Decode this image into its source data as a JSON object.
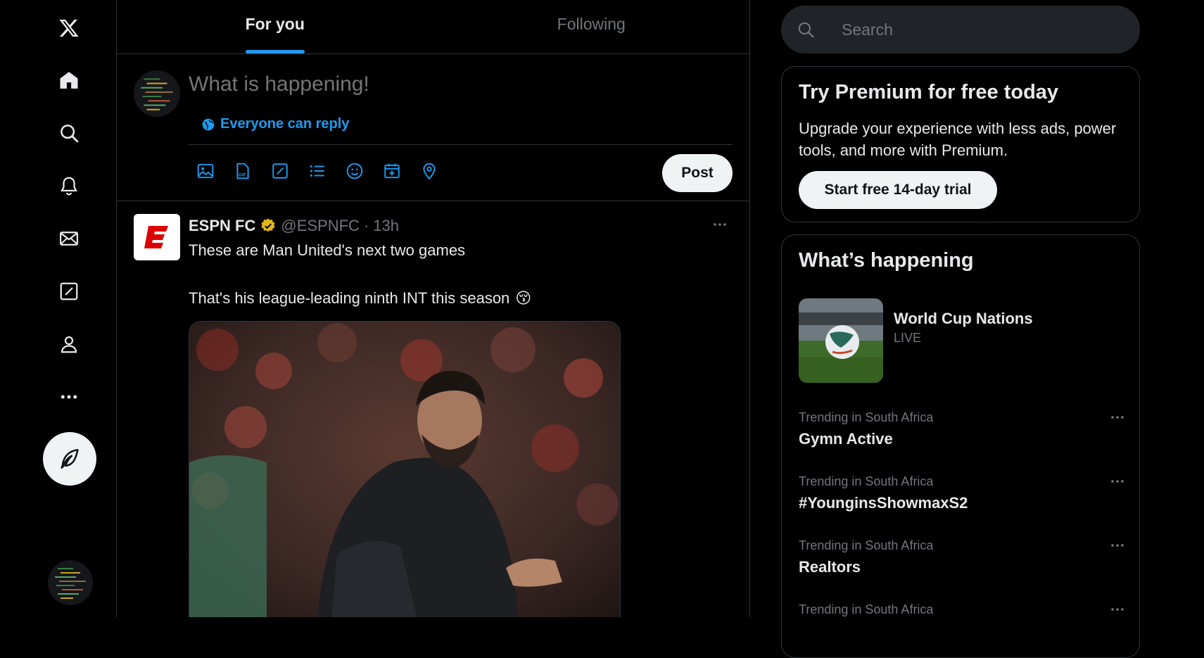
{
  "colors": {
    "background": "#000000",
    "accent": "#1d9bf0",
    "text": "#e7e9ea",
    "muted": "#71767b",
    "border": "#2f3336",
    "button_bg": "#eff3f4"
  },
  "nav": {
    "items": [
      {
        "icon": "x-logo-icon"
      },
      {
        "icon": "home-icon"
      },
      {
        "icon": "search-icon"
      },
      {
        "icon": "bell-icon"
      },
      {
        "icon": "mail-icon"
      },
      {
        "icon": "grok-icon"
      },
      {
        "icon": "profile-icon"
      },
      {
        "icon": "more-icon"
      }
    ],
    "compose_icon": "feather-icon"
  },
  "tabs": [
    {
      "label": "For you",
      "active": true
    },
    {
      "label": "Following",
      "active": false
    }
  ],
  "composer": {
    "placeholder": "What is happening!",
    "reply_scope": "Everyone can reply",
    "tools": [
      "image-icon",
      "gif-icon",
      "grok-icon",
      "poll-icon",
      "emoji-icon",
      "schedule-icon",
      "location-icon"
    ],
    "post_label": "Post"
  },
  "tweet": {
    "name": "ESPN FC",
    "handle": "@ESPNFC",
    "separator": "·",
    "time": "13h",
    "line1": "These are Man United's next two games",
    "line2": "That's his league-leading ninth INT this season",
    "emoji": "😚"
  },
  "search": {
    "placeholder": "Search"
  },
  "premium": {
    "title": "Try Premium for free today",
    "body": "Upgrade your experience with less ads, power tools, and more with Premium.",
    "button": "Start free 14-day trial"
  },
  "trends": {
    "title": "What’s happening",
    "event": {
      "title": "World Cup Nations",
      "status": "LIVE"
    },
    "items": [
      {
        "context": "Trending in South Africa",
        "name": "Gymn Active"
      },
      {
        "context": "Trending in South Africa",
        "name": "#YounginsShowmaxS2"
      },
      {
        "context": "Trending in South Africa",
        "name": "Realtors"
      },
      {
        "context": "Trending in South Africa",
        "name": ""
      }
    ]
  }
}
